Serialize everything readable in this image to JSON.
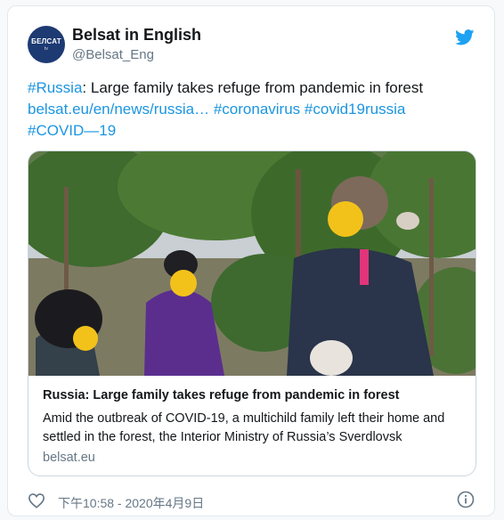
{
  "account": {
    "name": "Belsat in English",
    "handle": "@Belsat_Eng",
    "avatar_text": "БЕЛСАТ",
    "avatar_sub": "tv",
    "avatar_color": "#1d3a73"
  },
  "tweet": {
    "hashtag_russia": "#Russia",
    "text_main": ": Large family takes refuge from pandemic in forest",
    "link": "belsat.eu/en/news/russia…",
    "hashtag_coronavirus": "#coronavirus",
    "hashtag_covid19russia": "#covid19russia",
    "hashtag_covid19": "#COVID—19"
  },
  "card": {
    "title": "Russia: Large family takes refuge from pandemic in forest",
    "description": "Amid the outbreak of COVID-19, a multichild family left their home and settled in the forest, the Interior Ministry of Russia’s Sverdlovsk",
    "domain": "belsat.eu"
  },
  "footer": {
    "timestamp": "下午10:58 - 2020年4月9日"
  },
  "icons": {
    "brand": "twitter-bird-icon",
    "like": "heart-icon",
    "info": "info-icon"
  },
  "colors": {
    "link": "#1b95e0",
    "twitter_blue": "#1da1f2",
    "secondary_text": "#657786",
    "border": "#e1e8ed"
  }
}
